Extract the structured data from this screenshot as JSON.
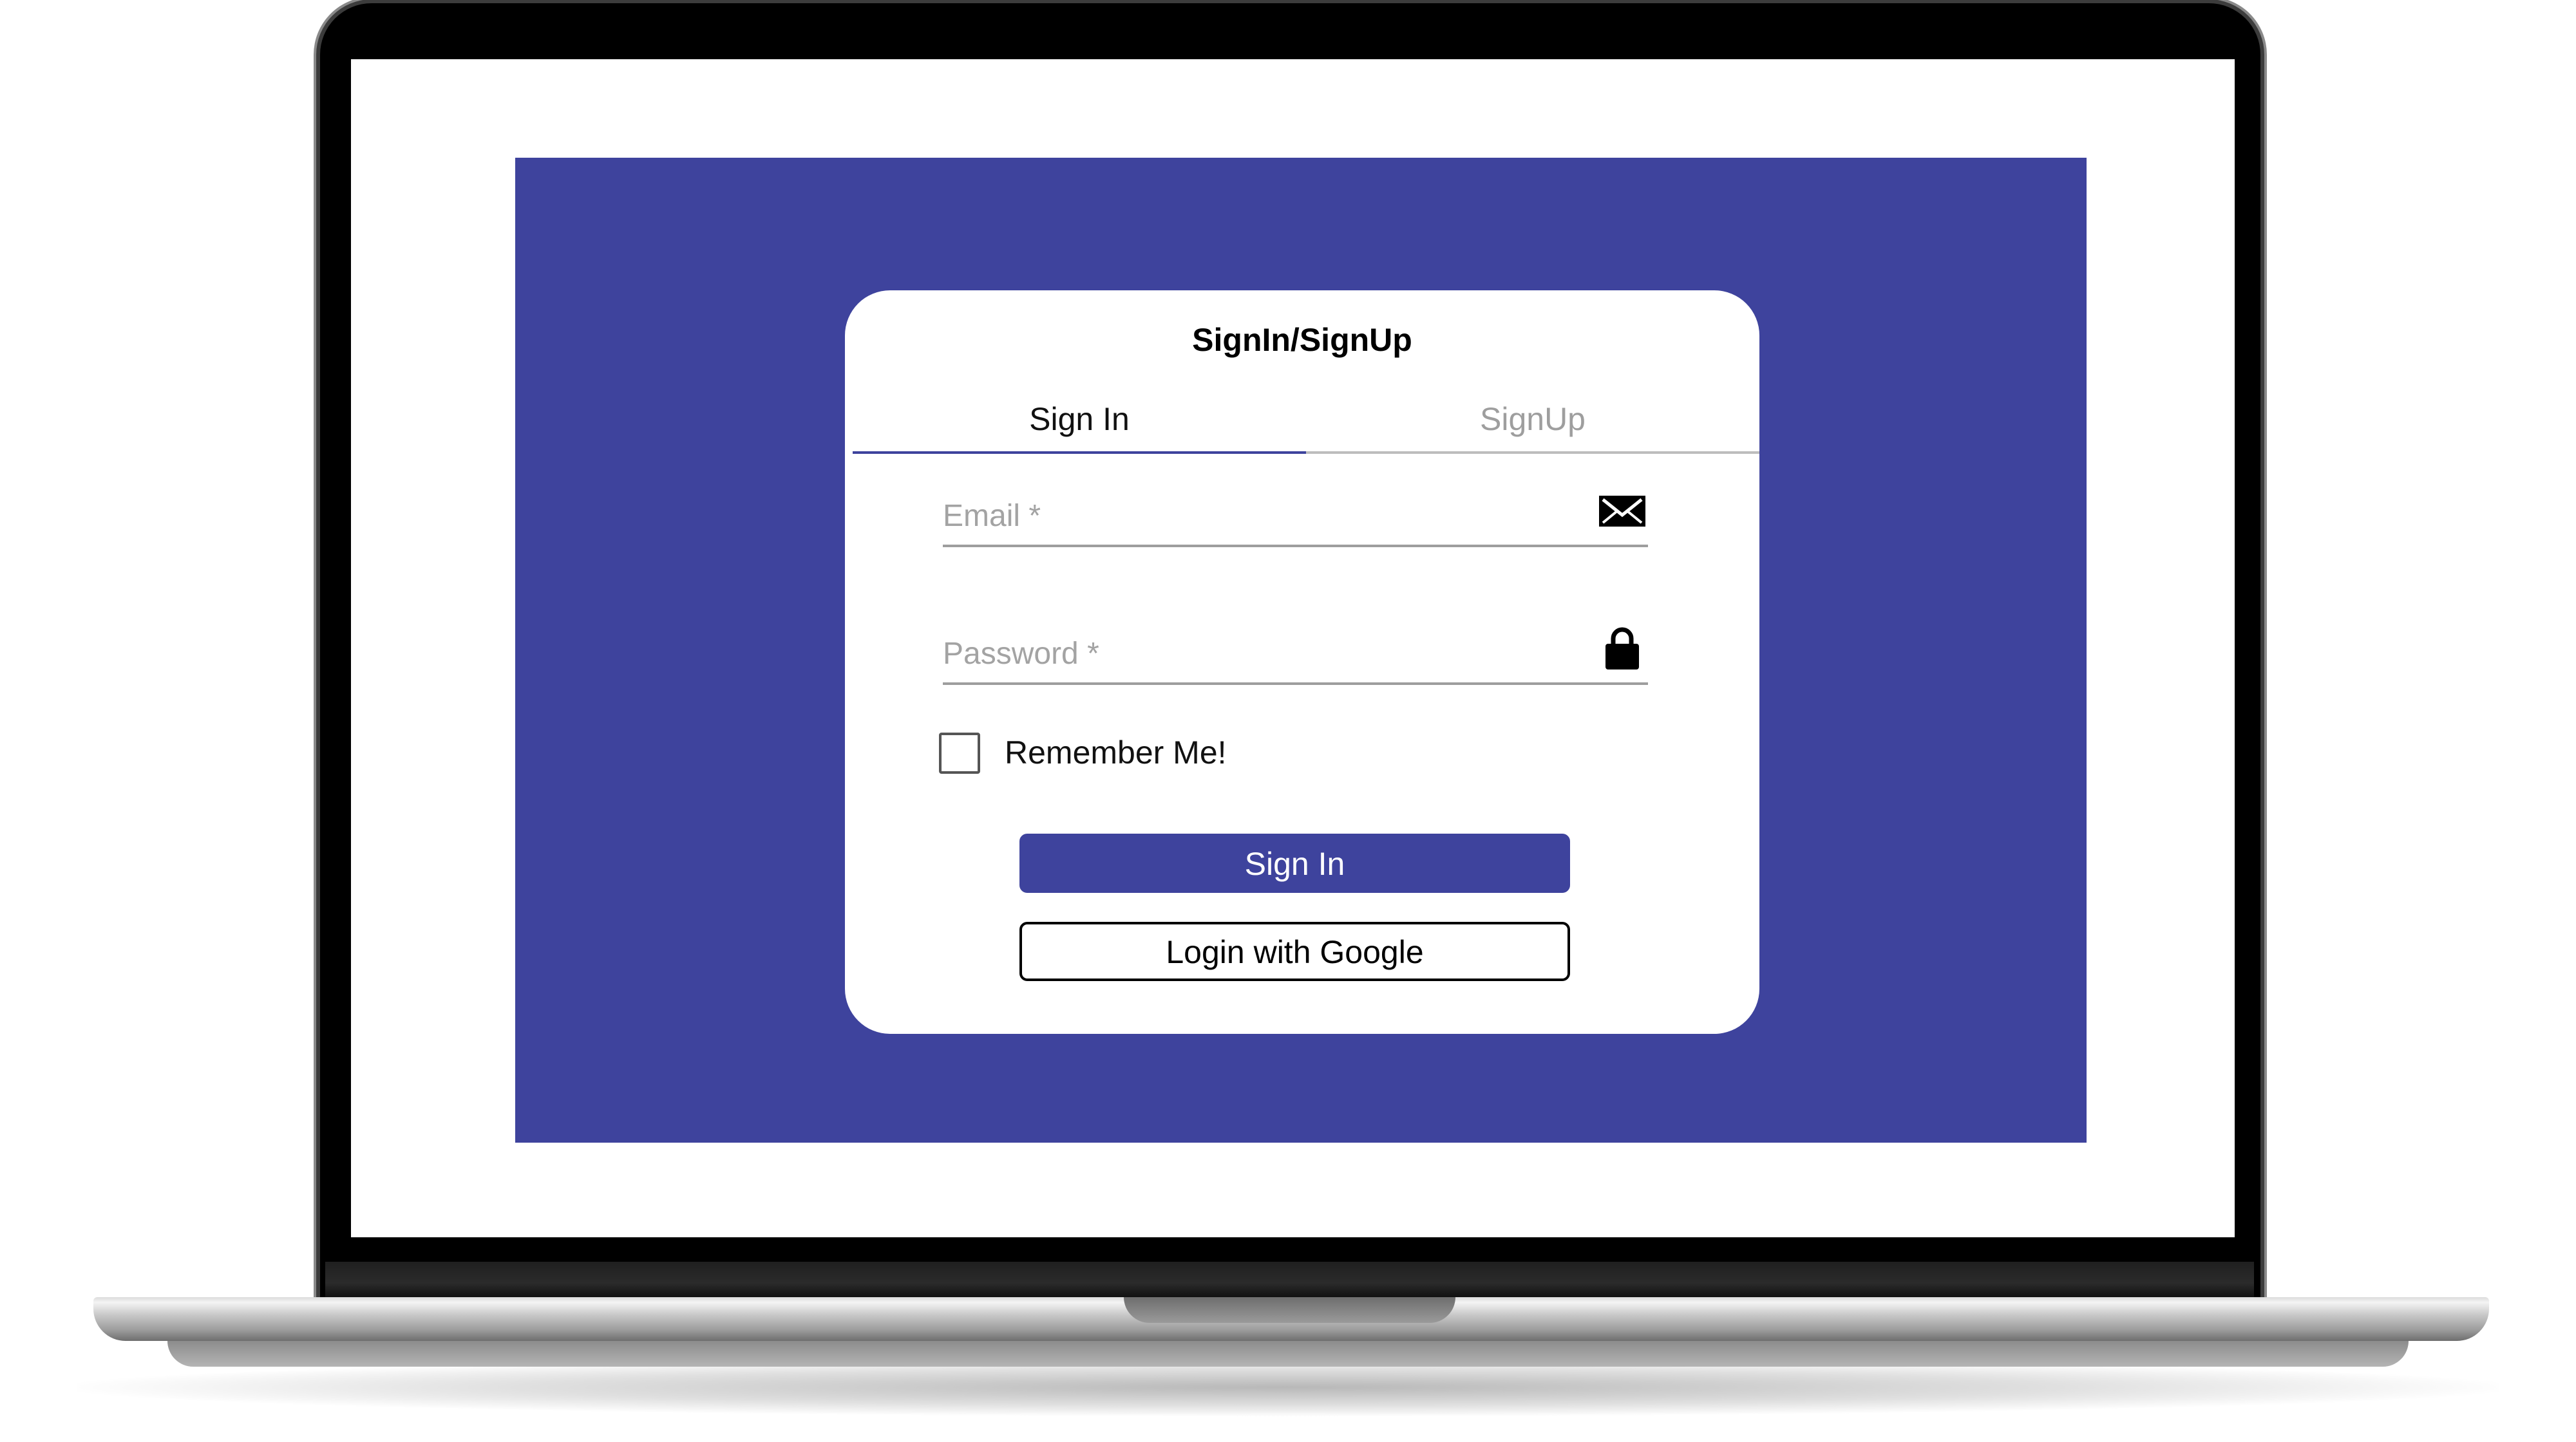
{
  "card": {
    "title": "SignIn/SignUp"
  },
  "tabs": [
    {
      "label": "Sign In",
      "active": true
    },
    {
      "label": "SignUp",
      "active": false
    }
  ],
  "form": {
    "email": {
      "placeholder": "Email *",
      "value": "",
      "icon": "envelope-icon"
    },
    "password": {
      "placeholder": "Password *",
      "value": "",
      "icon": "lock-icon"
    },
    "remember": {
      "label": "Remember Me!",
      "checked": false
    },
    "signin_button": "Sign In",
    "google_button": "Login with Google"
  },
  "colors": {
    "brand": "#3e439d",
    "card": "#ffffff",
    "muted_text": "#9e9e9e"
  }
}
